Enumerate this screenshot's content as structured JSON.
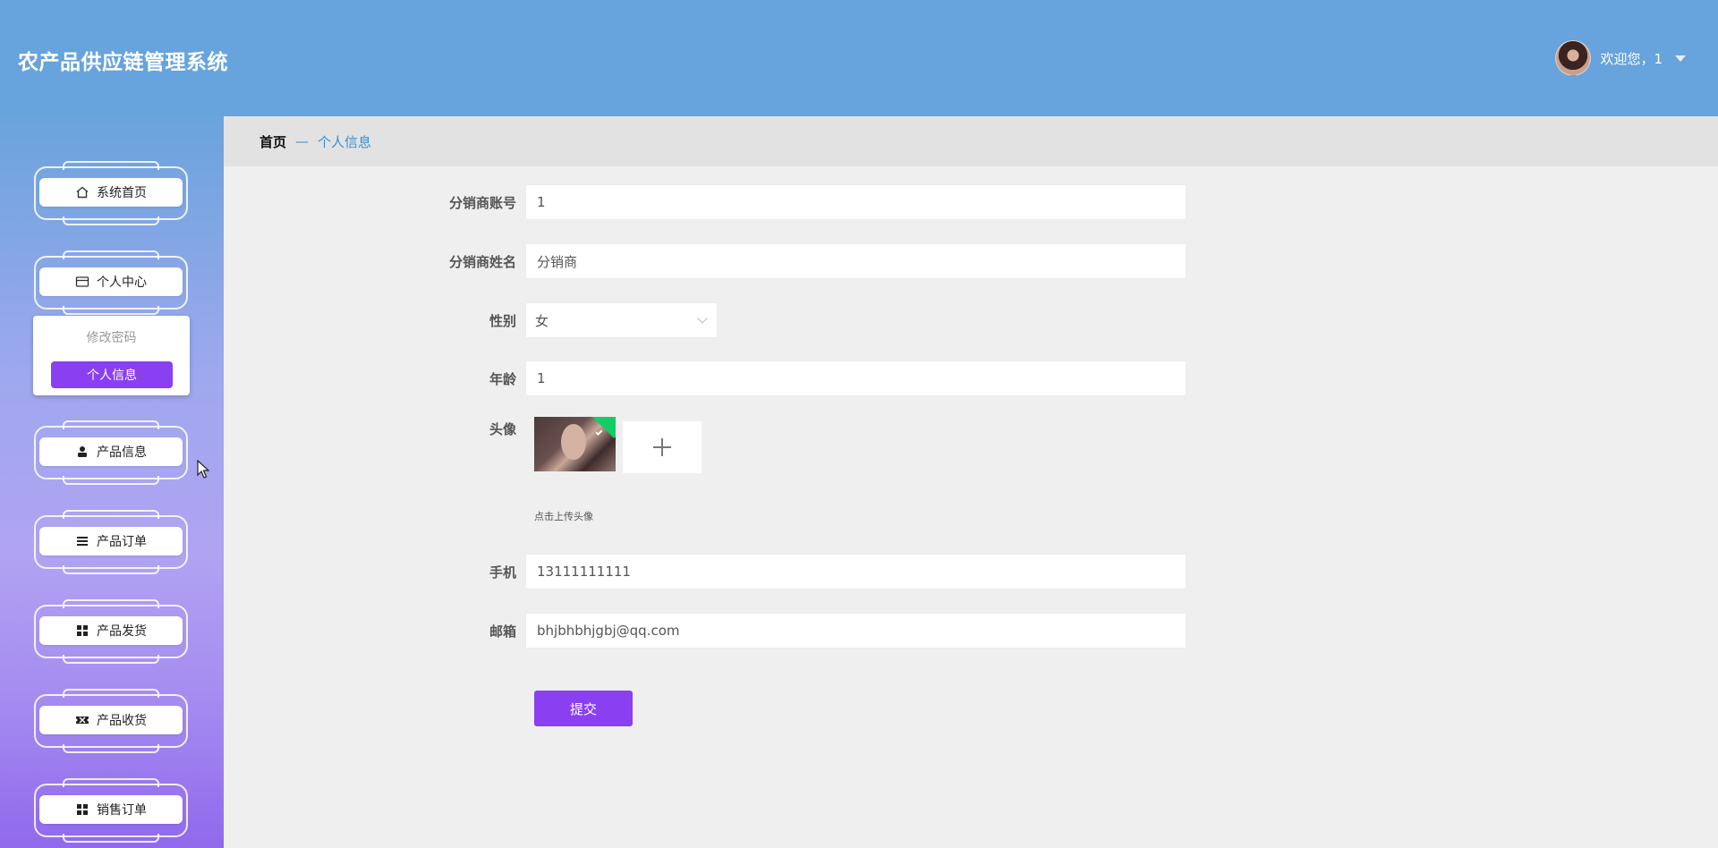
{
  "header": {
    "title": "农产品供应链管理系统",
    "welcome": "欢迎您，1"
  },
  "sidebar": {
    "items": [
      {
        "label": "系统首页",
        "icon": "home-icon"
      },
      {
        "label": "个人中心",
        "icon": "card-icon"
      },
      {
        "label": "产品信息",
        "icon": "person-icon"
      },
      {
        "label": "产品订单",
        "icon": "list-icon"
      },
      {
        "label": "产品发货",
        "icon": "grid-icon"
      },
      {
        "label": "产品收货",
        "icon": "ticket-icon"
      },
      {
        "label": "销售订单",
        "icon": "grid-icon"
      }
    ],
    "submenu": {
      "change_password": "修改密码",
      "personal_info": "个人信息"
    }
  },
  "breadcrumb": {
    "home": "首页",
    "separator": "—",
    "current": "个人信息"
  },
  "form": {
    "account_label": "分销商账号",
    "account_value": "1",
    "name_label": "分销商姓名",
    "name_value": "分销商",
    "gender_label": "性别",
    "gender_value": "女",
    "age_label": "年龄",
    "age_value": "1",
    "avatar_label": "头像",
    "avatar_hint": "点击上传头像",
    "phone_label": "手机",
    "phone_value": "13111111111",
    "email_label": "邮箱",
    "email_value": "bhjbhbhjgbj@qq.com",
    "submit_label": "提交"
  },
  "colors": {
    "header_bg": "#67a3dc",
    "accent": "#8a3ff0",
    "breadcrumb_link": "#3b8fd0"
  }
}
